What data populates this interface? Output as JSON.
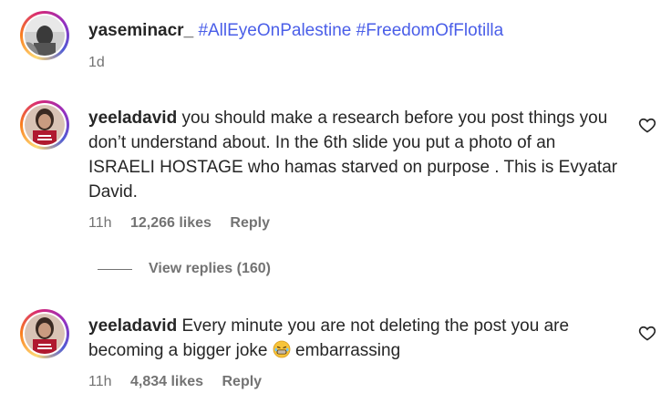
{
  "comments": [
    {
      "username": "yaseminacr_",
      "text_parts": [
        "#AllEyeOnPalestine",
        "#FreedomOfFlotilla"
      ],
      "time": "1d"
    },
    {
      "username": "yeeladavid",
      "text": "you should make a research before you post things you don’t understand about. In the 6th slide you put a photo of an ISRAELI HOSTAGE who hamas starved on purpose . This is Evyatar David.",
      "time": "11h",
      "likes": "12,266 likes",
      "reply": "Reply"
    },
    {
      "username": "yeeladavid",
      "text_before_emoji": "Every minute you are not deleting the post you are becoming a bigger joke",
      "emoji": "grimacing-laughing-emoji",
      "text_after_emoji": "embarrassing",
      "time": "11h",
      "likes": "4,834 likes",
      "reply": "Reply"
    }
  ],
  "view_replies": "View replies (160)",
  "colors": {
    "hashtag": "#4a5ee8",
    "text": "#262626",
    "muted": "#737373"
  }
}
